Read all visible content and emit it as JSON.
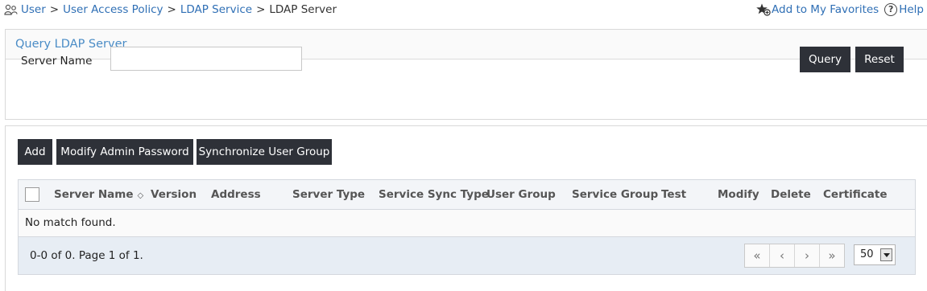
{
  "breadcrumb": {
    "items": [
      "User",
      "User Access Policy",
      "LDAP Service"
    ],
    "separator": ">",
    "current": "LDAP Server"
  },
  "toplinks": {
    "favorites": "Add to My Favorites",
    "help": "Help"
  },
  "query": {
    "title": "Query LDAP Server",
    "server_name_label": "Server Name",
    "server_name_value": "",
    "query_button": "Query",
    "reset_button": "Reset"
  },
  "toolbar": {
    "add": "Add",
    "modify_admin_password": "Modify Admin Password",
    "synchronize_user_group": "Synchronize User Group"
  },
  "table": {
    "columns": [
      "Server Name",
      "Version",
      "Address",
      "Server Type",
      "Service Sync Type",
      "User Group",
      "Service Group",
      "Test",
      "Modify",
      "Delete",
      "Certificate"
    ],
    "empty_message": "No match found."
  },
  "pager": {
    "info": "0-0 of 0. Page 1 of 1.",
    "first": "«",
    "prev": "‹",
    "next": "›",
    "last": "»",
    "page_size": "50"
  },
  "colors": {
    "link": "#2f6fb5",
    "button_bg": "#2e3138",
    "panel_title": "#4a8cc6"
  }
}
